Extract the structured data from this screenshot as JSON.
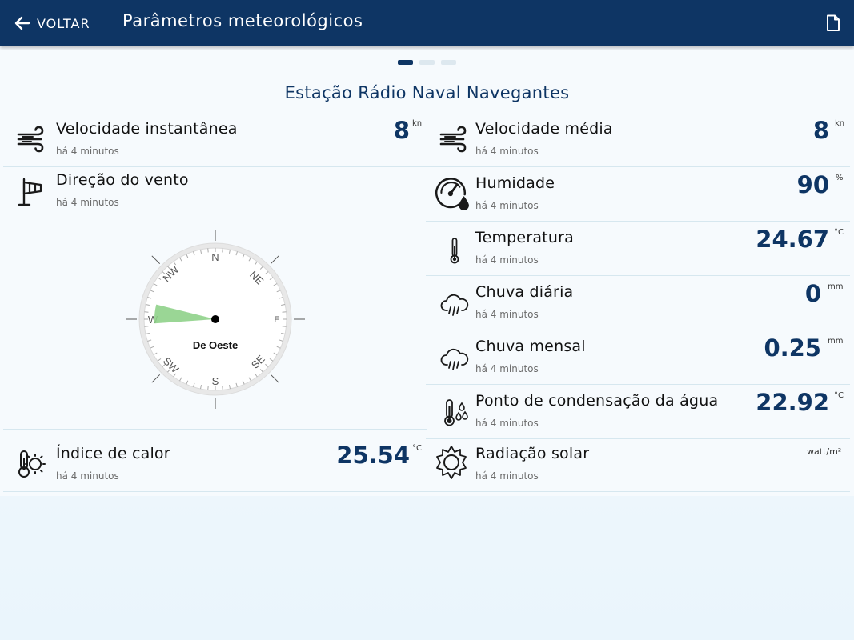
{
  "header": {
    "back_label": "VOLTAR",
    "title": "Parâmetros meteorológicos"
  },
  "pager": {
    "pages": 3,
    "active": 1
  },
  "station": {
    "name": "Estação Rádio Naval Navegantes"
  },
  "updated_ago": "há 4 minutos",
  "left": {
    "wind_speed": {
      "label": "Velocidade instantânea",
      "value": "8",
      "unit": "kn",
      "icon": "wind-icon"
    },
    "wind_direction": {
      "label": "Direção do vento",
      "icon": "windsock-icon",
      "compass": {
        "n": "N",
        "ne": "NE",
        "e": "E",
        "se": "SE",
        "s": "S",
        "sw": "SW",
        "w": "W",
        "nw": "NW",
        "reading": "De Oeste",
        "direction_degrees": 275,
        "sector_color": "#8fd18a"
      }
    },
    "heat_index": {
      "label": "Índice de calor",
      "value": "25.54",
      "unit": "°C",
      "icon": "heat-index-icon"
    }
  },
  "right": {
    "avg_speed": {
      "label": "Velocidade média",
      "value": "8",
      "unit": "kn",
      "icon": "wind-icon"
    },
    "humidity": {
      "label": "Humidade",
      "value": "90",
      "unit": "%",
      "icon": "humidity-gauge-icon"
    },
    "temperature": {
      "label": "Temperatura",
      "value": "24.67",
      "unit": "°C",
      "icon": "thermometer-icon"
    },
    "daily_rain": {
      "label": "Chuva diária",
      "value": "0",
      "unit": "mm",
      "icon": "rain-cloud-icon"
    },
    "monthly_rain": {
      "label": "Chuva mensal",
      "value": "0.25",
      "unit": "mm",
      "icon": "rain-cloud-icon"
    },
    "dew_point": {
      "label": "Ponto de condensação da água",
      "value": "22.92",
      "unit": "°C",
      "icon": "dew-point-icon"
    },
    "solar_radiation": {
      "label": "Radiação solar",
      "value": "",
      "unit": "watt/m²",
      "icon": "sun-icon"
    }
  },
  "colors": {
    "primary": "#0e3564",
    "divider": "#d6e7ef",
    "wind_sector": "#8fd18a"
  }
}
